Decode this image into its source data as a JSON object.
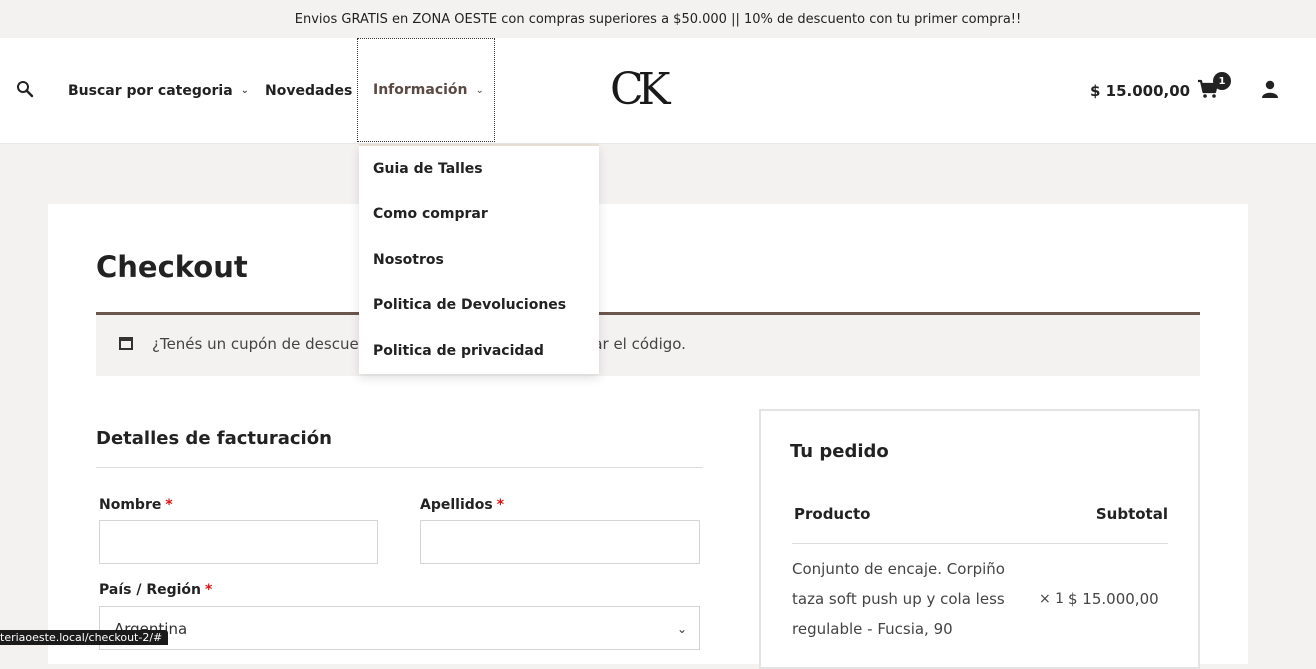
{
  "announcement": "Envios GRATIS en ZONA OESTE con compras superiores a $50.000 || 10% de descuento con tu primer compra!!",
  "nav": {
    "category": "Buscar por categoria",
    "new": "Novedades",
    "info": "Información"
  },
  "logo": "CK",
  "cart": {
    "total": "$ 15.000,00",
    "count": "1"
  },
  "dropdown": {
    "items": [
      "Guia de Talles",
      "Como comprar",
      "Nosotros",
      "Politica de Devoluciones",
      "Politica de privacidad"
    ]
  },
  "page": {
    "title": "Checkout"
  },
  "coupon": {
    "text": "¿Tenés un cupón de descuento?",
    "link": "Hacé click acá para ingresar el código."
  },
  "billing": {
    "title": "Detalles de facturación",
    "first_name_label": "Nombre",
    "last_name_label": "Apellidos",
    "country_label": "País / Región",
    "country_value": "Argentina",
    "required_mark": "*"
  },
  "order": {
    "title": "Tu pedido",
    "col_product": "Producto",
    "col_subtotal": "Subtotal",
    "item_name": "Conjunto de encaje. Corpiño taza soft push up y cola less regulable - Fucsia, 90",
    "item_qty": "× 1",
    "item_subtotal": "$ 15.000,00"
  },
  "status_url": "teriaoeste.local/checkout-2/#",
  "colors": {
    "accent": "#6b564c",
    "background": "#f4f2f1"
  }
}
